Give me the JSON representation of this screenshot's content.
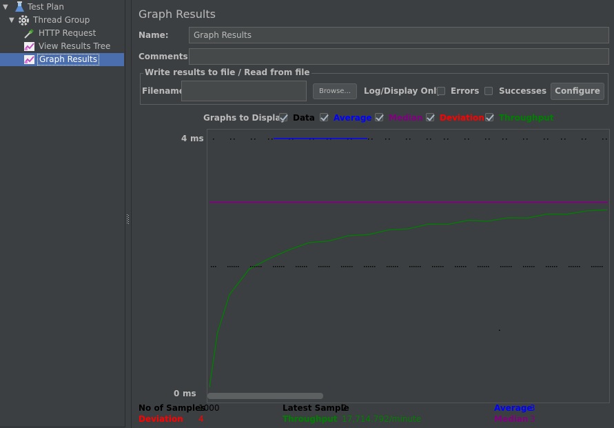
{
  "tree": {
    "items": [
      {
        "label": "Test Plan",
        "icon": "test-plan-flask-icon",
        "level": 0,
        "expanded": true
      },
      {
        "label": "Thread Group",
        "icon": "thread-group-gear-icon",
        "level": 1,
        "expanded": true
      },
      {
        "label": "HTTP Request",
        "icon": "http-request-pipette-icon",
        "level": 2
      },
      {
        "label": "View Results Tree",
        "icon": "listener-chart-icon",
        "level": 2
      },
      {
        "label": "Graph Results",
        "icon": "listener-chart-icon",
        "level": 2,
        "selected": true
      }
    ]
  },
  "panel": {
    "title": "Graph Results",
    "name_label": "Name:",
    "name_value": "Graph Results",
    "comments_label": "Comments:",
    "comments_value": ""
  },
  "file_group": {
    "title": "Write results to file / Read from file",
    "filename_label": "Filename",
    "filename_value": "",
    "browse_label": "Browse...",
    "log_display_label": "Log/Display Only:",
    "errors_label": "Errors",
    "errors_checked": false,
    "successes_label": "Successes",
    "successes_checked": false,
    "configure_label": "Configure"
  },
  "graphs_to_display": {
    "label": "Graphs to Display",
    "options": [
      {
        "label": "Data",
        "checked": true,
        "color": "#000000"
      },
      {
        "label": "Average",
        "checked": true,
        "color": "#0000ff"
      },
      {
        "label": "Median",
        "checked": true,
        "color": "#800080"
      },
      {
        "label": "Deviation",
        "checked": true,
        "color": "#ff0000"
      },
      {
        "label": "Throughput",
        "checked": true,
        "color": "#008000"
      }
    ]
  },
  "graph": {
    "y_max_label": "4",
    "y_min_label": "0",
    "y_unit": "ms"
  },
  "chart_data": {
    "type": "line",
    "ylim": [
      0,
      4
    ],
    "ylabel": "ms",
    "series": [
      {
        "name": "Median",
        "color": "#800080",
        "values": [
          3,
          3
        ]
      },
      {
        "name": "Throughput",
        "color": "#008000",
        "x": [
          0,
          2,
          5,
          10,
          15,
          20,
          25,
          30,
          35,
          40,
          45,
          50,
          55,
          60,
          65,
          70,
          75,
          80,
          85,
          90,
          95,
          100
        ],
        "values": [
          0.1,
          0.95,
          1.55,
          1.97,
          2.1,
          2.27,
          2.35,
          2.41,
          2.46,
          2.51,
          2.55,
          2.6,
          2.64,
          2.67,
          2.7,
          2.72,
          2.74,
          2.77,
          2.8,
          2.83,
          2.85,
          2.9
        ]
      },
      {
        "name": "Data",
        "color": "#000000",
        "values": [
          2,
          2,
          1
        ]
      }
    ]
  },
  "stats": {
    "samples_label": "No of Samples",
    "samples_value": "1000",
    "latest_label": "Latest Sample",
    "latest_value": "2",
    "average_label": "Average",
    "average_value": "3",
    "deviation_label": "Deviation",
    "deviation_value": "4",
    "throughput_label": "Throughput",
    "throughput_value": "17,714.792/minute",
    "median_label": "Median",
    "median_value": "3"
  },
  "colors": {
    "background": "#3c3f41",
    "selection": "#4b6eaf",
    "text": "#bbbbbb"
  }
}
